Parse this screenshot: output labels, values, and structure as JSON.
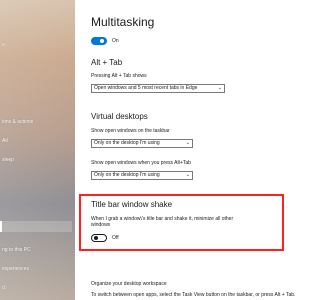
{
  "window": {
    "title": "Multitasking"
  },
  "sidebar": {
    "items": [
      {
        "label": "e"
      },
      {
        "label": ""
      },
      {
        "label": ""
      },
      {
        "label": "ions & actions"
      },
      {
        "label": "Alt"
      },
      {
        "label": ""
      },
      {
        "label": "sleep"
      },
      {
        "label": ""
      },
      {
        "label": ""
      },
      {
        "label": ""
      },
      {
        "label": "ng to this PC"
      },
      {
        "label": ""
      },
      {
        "label": "experiences"
      },
      {
        "label": "d"
      }
    ]
  },
  "content": {
    "top_toggle": {
      "label": "On",
      "state": "on"
    },
    "alt_tab": {
      "title": "Alt + Tab",
      "label": "Pressing Alt + Tab shows",
      "value": "Open windows and 5 most recent tabs in Edge"
    },
    "virtual_desktops": {
      "title": "Virtual desktops",
      "taskbar_label": "Show open windows on the taskbar",
      "taskbar_value": "Only on the desktop I'm using",
      "alt_tab_label": "Show open windows when you press Alt+Tab",
      "alt_tab_value": "Only on the desktop I'm using"
    },
    "title_bar_shake": {
      "title": "Title bar window shake",
      "description_line1": "When I grab a window\\'s title bar and shake it, minimize all other",
      "description_line2": "windows",
      "toggle_label": "Off",
      "state": "off"
    },
    "footer": {
      "title": "Organize your desktop workspace",
      "text": "To switch between open apps, select the Task View button on the taskbar, or press Alt + Tab."
    }
  },
  "colors": {
    "accent": "#0078d7",
    "highlight_border": "#ff2020",
    "text": "#1b1b1b",
    "background": "#ffffff"
  }
}
